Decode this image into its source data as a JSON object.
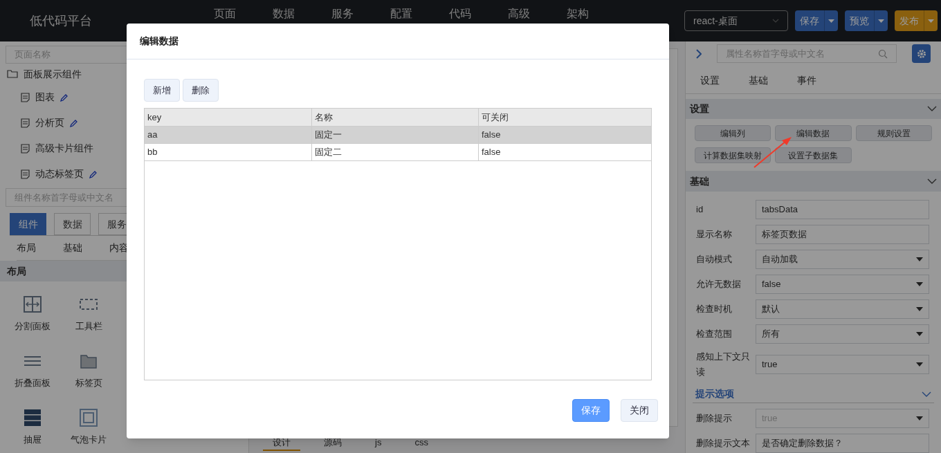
{
  "header": {
    "logo": "低代码平台",
    "nav": [
      "页面",
      "数据",
      "服务",
      "配置",
      "代码",
      "高级",
      "架构"
    ],
    "platform": "react-桌面",
    "actions": [
      {
        "label": "保存",
        "kind": "primary"
      },
      {
        "label": "预览",
        "kind": "primary"
      },
      {
        "label": "发布",
        "kind": "warning"
      }
    ]
  },
  "left_panel": {
    "page_search": {
      "placeholder": "页面名称"
    },
    "tree": {
      "label": "面板展示组件",
      "children": [
        {
          "label": "图表",
          "editable": true
        },
        {
          "label": "分析页",
          "editable": true
        },
        {
          "label": "高级卡片组件",
          "editable": false
        },
        {
          "label": "动态标签页",
          "editable": true
        }
      ]
    },
    "component_search": {
      "placeholder": "组件名称首字母或中文名"
    },
    "tabs": [
      {
        "label": "组件",
        "selected": true
      },
      {
        "label": "数据",
        "selected": false
      },
      {
        "label": "服务",
        "selected": false
      }
    ],
    "categories": [
      "布局",
      "基础",
      "内容"
    ],
    "section": "布局",
    "components": [
      {
        "label": "分割面板",
        "kind": "split"
      },
      {
        "label": "工具栏",
        "kind": "toolbar"
      },
      {
        "label": "折叠面板",
        "kind": "collapse"
      },
      {
        "label": "标签页",
        "kind": "folder"
      },
      {
        "label": "抽屉",
        "kind": "drawer"
      },
      {
        "label": "气泡卡片",
        "kind": "card"
      }
    ]
  },
  "editor_tabs": [
    {
      "label": "设计",
      "selected": true
    },
    {
      "label": "源码",
      "selected": false
    },
    {
      "label": "js",
      "selected": false
    },
    {
      "label": "css",
      "selected": false
    }
  ],
  "right_panel": {
    "search": {
      "placeholder": "属性名称首字母或中文名"
    },
    "tabs": [
      "设置",
      "基础",
      "事件"
    ],
    "settings": {
      "title": "设置",
      "buttons": [
        "编辑列",
        "编辑数据",
        "规则设置",
        "计算数据集映射",
        "设置子数据集"
      ]
    },
    "basic": {
      "title": "基础",
      "fields": [
        {
          "label": "id",
          "value": "tabsData",
          "kind": "input",
          "disabled": false
        },
        {
          "label": "显示名称",
          "value": "标签页数据",
          "kind": "input",
          "disabled": false
        },
        {
          "label": "自动模式",
          "value": "自动加载",
          "kind": "select",
          "disabled": false
        },
        {
          "label": "允许无数据",
          "value": "false",
          "kind": "select",
          "disabled": false
        },
        {
          "label": "检查时机",
          "value": "默认",
          "kind": "select",
          "disabled": false
        },
        {
          "label": "检查范围",
          "value": "所有",
          "kind": "select",
          "disabled": false
        },
        {
          "label": "感知上下文只读",
          "value": "true",
          "kind": "select",
          "disabled": false
        }
      ]
    },
    "hint": {
      "title": "提示选项",
      "fields": [
        {
          "label": "删除提示",
          "value": "true",
          "kind": "select",
          "disabled": true
        },
        {
          "label": "删除提示文本",
          "value": "是否确定删除数据？",
          "kind": "input",
          "disabled": false
        }
      ]
    }
  },
  "dialog": {
    "title": "编辑数据",
    "toolbar": [
      "新增",
      "删除"
    ],
    "columns": [
      "key",
      "名称",
      "可关闭"
    ],
    "rows": [
      {
        "cells": [
          "aa",
          "固定一",
          "false"
        ],
        "selected": true
      },
      {
        "cells": [
          "bb",
          "固定二",
          "false"
        ],
        "selected": false
      }
    ],
    "footer": [
      {
        "label": "保存",
        "kind": "primary"
      },
      {
        "label": "关闭",
        "kind": "default"
      }
    ]
  }
}
